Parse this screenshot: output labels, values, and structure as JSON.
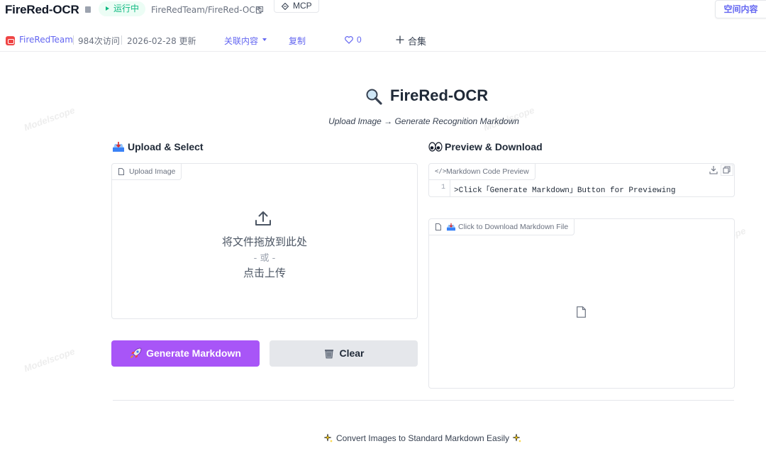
{
  "topbar": {
    "app_title": "FireRed-OCR",
    "status": "运行中",
    "repo_path": "FireRedTeam/FireRed-OCR",
    "mcp_label": "MCP"
  },
  "meta": {
    "team": "FireRedTeam",
    "visits": "984次访问",
    "updated": "2026-02-28 更新",
    "related": "关联内容",
    "duplicate": "复制",
    "likes": "0",
    "collection": "合集",
    "space_content": "空间内容"
  },
  "watermark": "Modelscope",
  "header": {
    "title": "FireRed-OCR",
    "subtitle": "Upload Image → Generate Recognition Markdown"
  },
  "left": {
    "heading": "Upload & Select",
    "upload_label": "Upload Image",
    "drop_text": "将文件拖放到此处",
    "or_text": "- 或 -",
    "click_text": "点击上传",
    "generate_button": "Generate Markdown",
    "clear_button": "Clear"
  },
  "right": {
    "heading": "Preview & Download",
    "code_label": "Markdown Code Preview",
    "code_line_number": "1",
    "code_text": ">Click「Generate Markdown」Button for Previewing",
    "download_label": "Click to Download Markdown File"
  },
  "footer": {
    "text": "Convert Images to Standard Markdown Easily"
  },
  "colors": {
    "accent": "#a855f7",
    "link": "#6366f1",
    "status_green": "#10b981",
    "clear_bg": "#e5e7eb"
  },
  "icons": [
    "copy-icon",
    "mcp-icon",
    "heart-icon",
    "plus-icon",
    "magnifier-icon",
    "inbox-tray-icon",
    "eyes-icon",
    "file-icon",
    "upload-icon",
    "rocket-icon",
    "trash-icon",
    "download-icon",
    "sparkle-icon"
  ]
}
